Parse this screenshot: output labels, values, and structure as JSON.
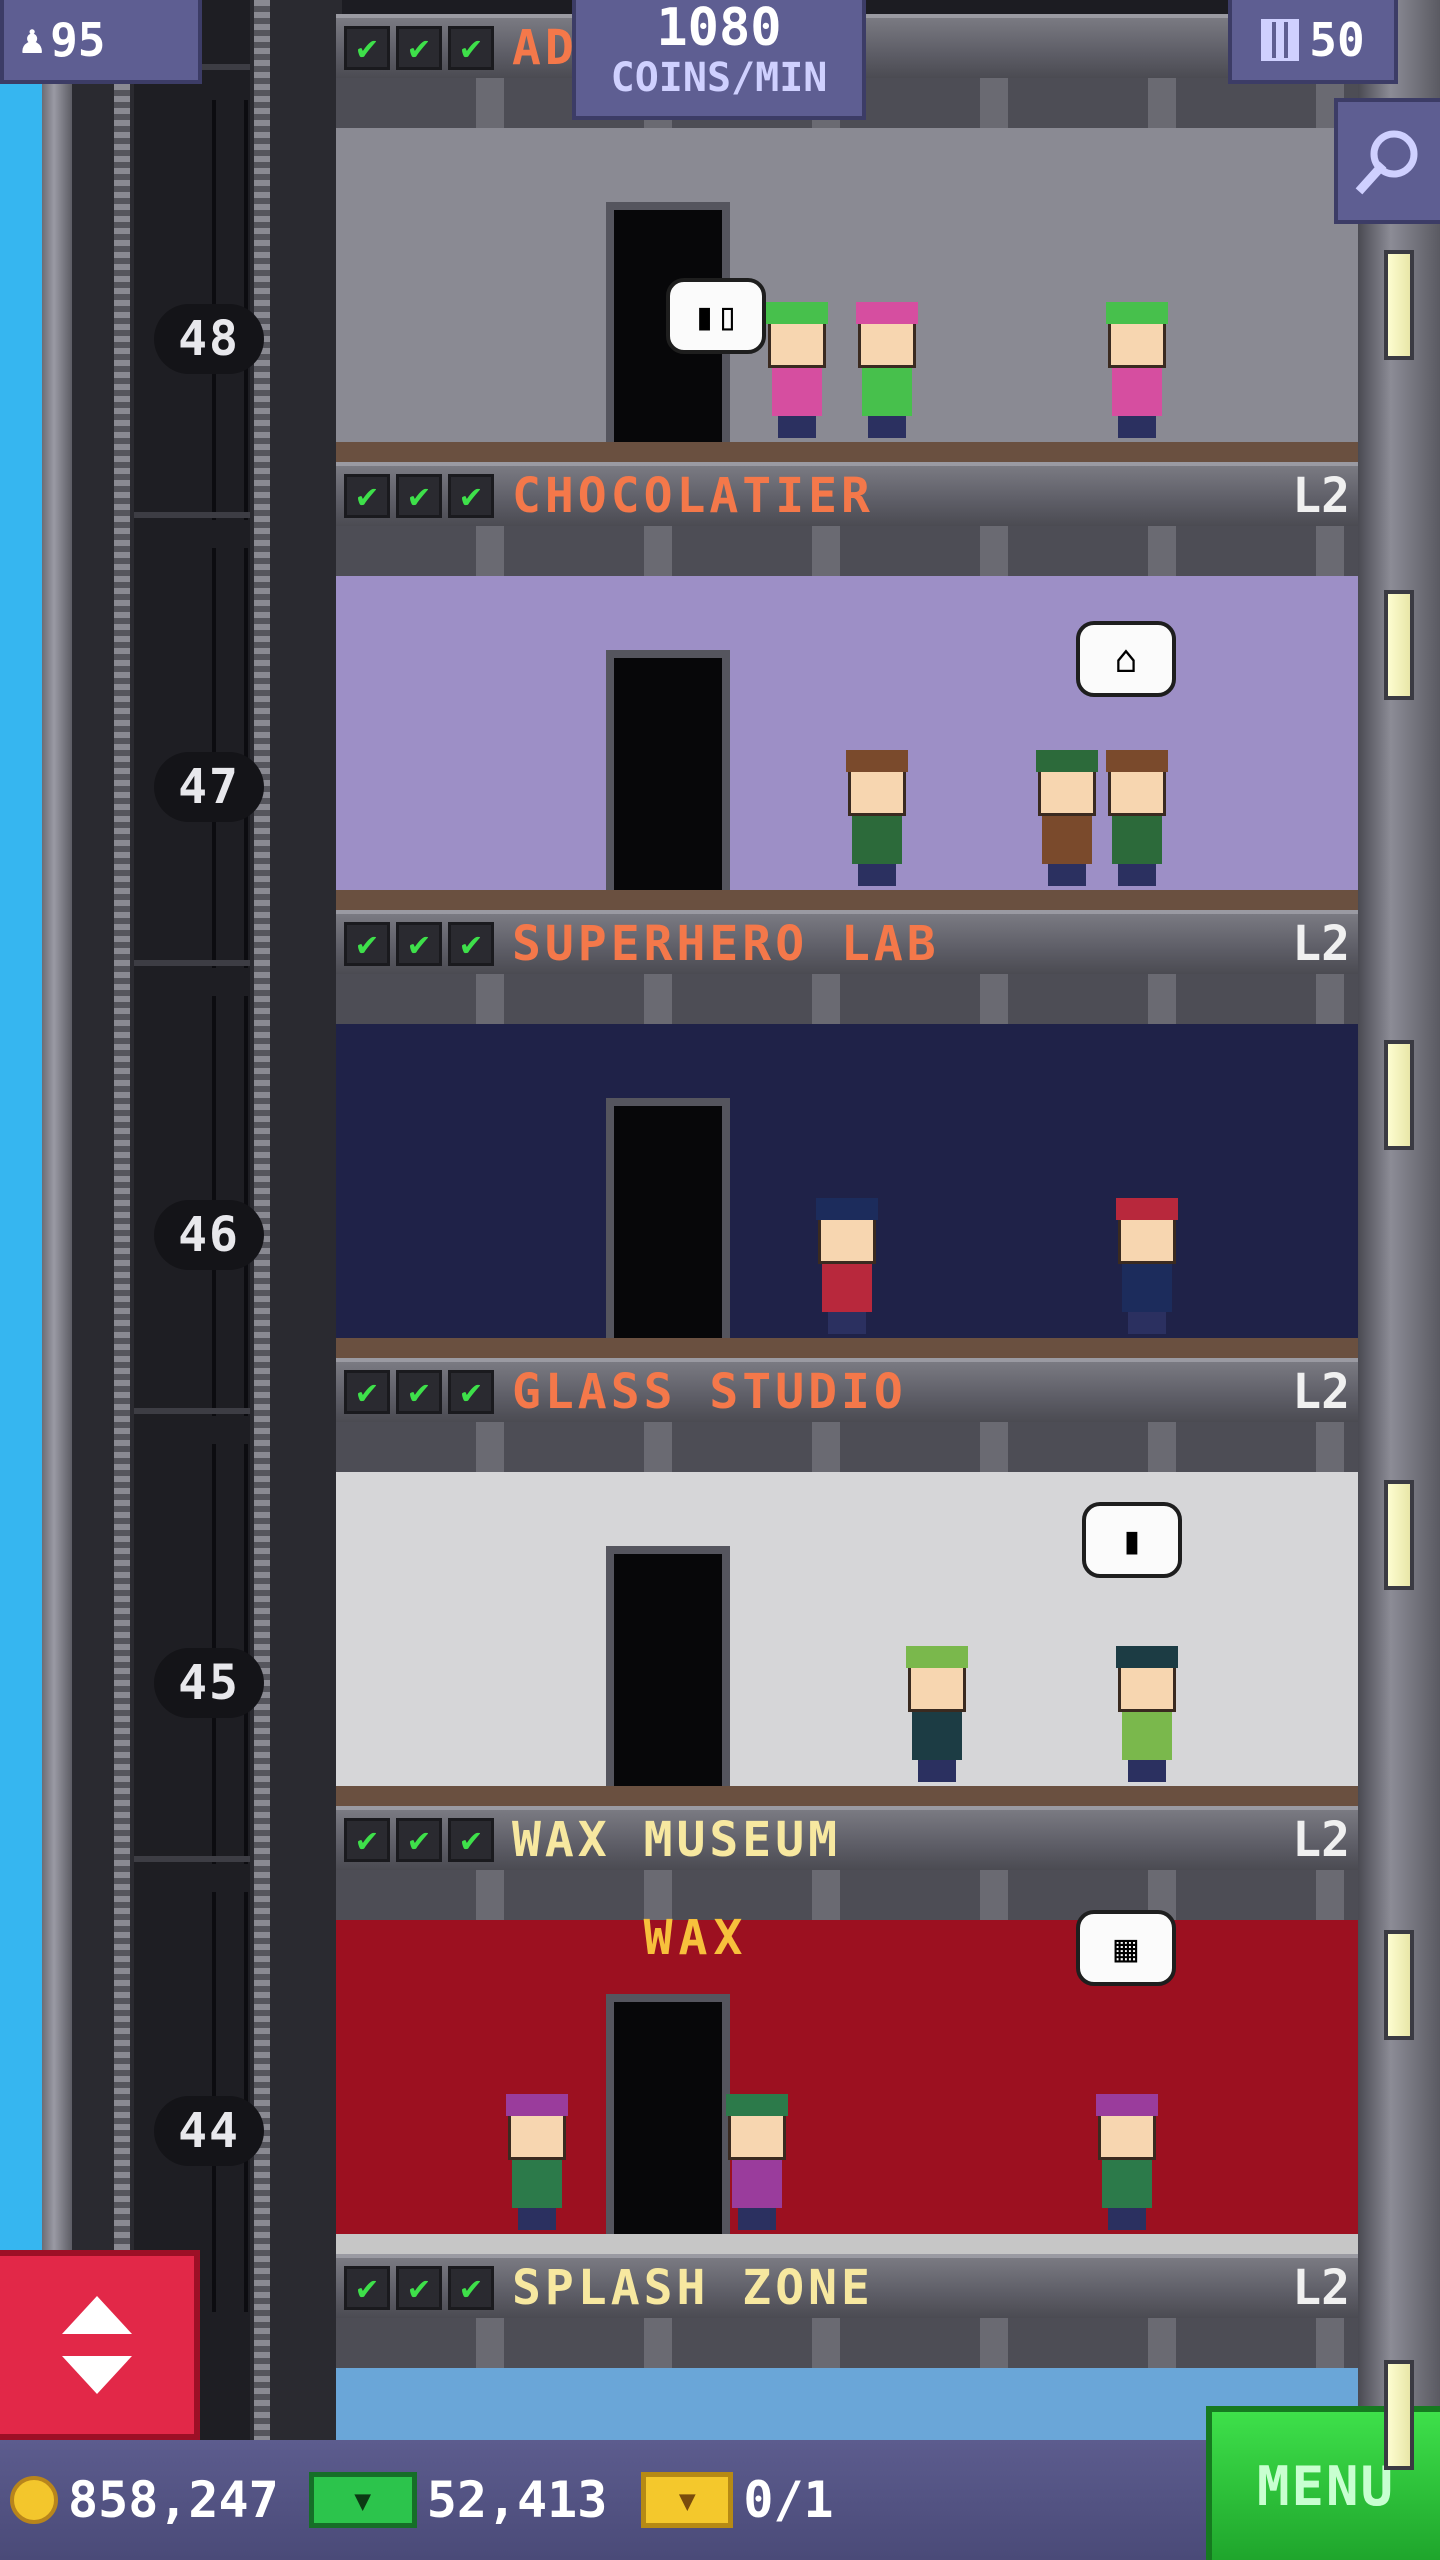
{
  "hud": {
    "population": "95",
    "coins_per_min_value": "1080",
    "coins_per_min_label": "COINS/MIN",
    "floor_count": "50"
  },
  "elevator_shaft": {
    "floor_numbers": [
      "48",
      "47",
      "46",
      "45",
      "44"
    ]
  },
  "floors": [
    {
      "name": "AD",
      "level": "",
      "color": "#f4784a",
      "room_bg": "#8a8a93",
      "bubble": "▮▯"
    },
    {
      "name": "CHOCOLATIER",
      "level": "L2",
      "color": "#f4784a",
      "room_bg": "#9d8fc6",
      "bubble": "⌂"
    },
    {
      "name": "SUPERHERO LAB",
      "level": "L2",
      "color": "#f4784a",
      "room_bg": "#1f2248",
      "bubble": ""
    },
    {
      "name": "GLASS STUDIO",
      "level": "L2",
      "color": "#f4784a",
      "room_bg": "#d6d6d8",
      "bubble": "▮"
    },
    {
      "name": "WAX MUSEUM",
      "level": "L2",
      "color": "#f7e8a0",
      "room_bg": "#9c1020",
      "bubble": "▦"
    },
    {
      "name": "SPLASH ZONE",
      "level": "L2",
      "color": "#f7e8a0",
      "room_bg": "#6aa6d8",
      "bubble": ""
    }
  ],
  "wax_sign": "WAX",
  "bottom_bar": {
    "coins": "858,247",
    "bux": "52,413",
    "tickets": "0/1",
    "menu_label": "MENU"
  },
  "colors": {
    "hud_bg": "#5e5e92",
    "check_green": "#3ee04a",
    "menu_green": "#2ecc40",
    "elevator_red": "#e22848"
  }
}
